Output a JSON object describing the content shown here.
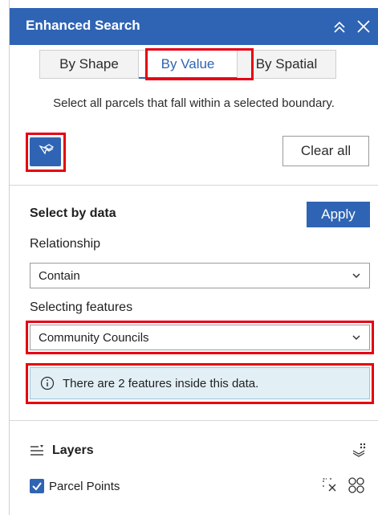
{
  "header": {
    "title": "Enhanced Search",
    "collapse_icon": "double-chevron-up-icon",
    "close_icon": "close-icon",
    "bg_color": "#2f64b4"
  },
  "tabs": [
    {
      "label": "By Shape",
      "active": false
    },
    {
      "label": "By Value",
      "active": true
    },
    {
      "label": "By Spatial",
      "active": false
    }
  ],
  "description": "Select all parcels that fall within a selected boundary.",
  "toolbar": {
    "select_tool_icon": "select-features-icon",
    "clear_label": "Clear all"
  },
  "select_by_data": {
    "title": "Select by data",
    "apply_label": "Apply",
    "relationship_label": "Relationship",
    "relationship_value": "Contain",
    "selecting_label": "Selecting features",
    "selecting_value": "Community Councils",
    "notice_text": "There are 2 features inside this data.",
    "notice_icon": "info-icon"
  },
  "layers": {
    "title": "Layers",
    "header_icon": "layers-list-icon",
    "options_icon": "layer-options-icon",
    "items": [
      {
        "label": "Parcel Points",
        "checked": true,
        "clear_icon": "clear-selection-icon",
        "select_icon": "select-group-icon"
      }
    ]
  },
  "accent_color": "#2f64b4",
  "highlight_color": "#e60012"
}
